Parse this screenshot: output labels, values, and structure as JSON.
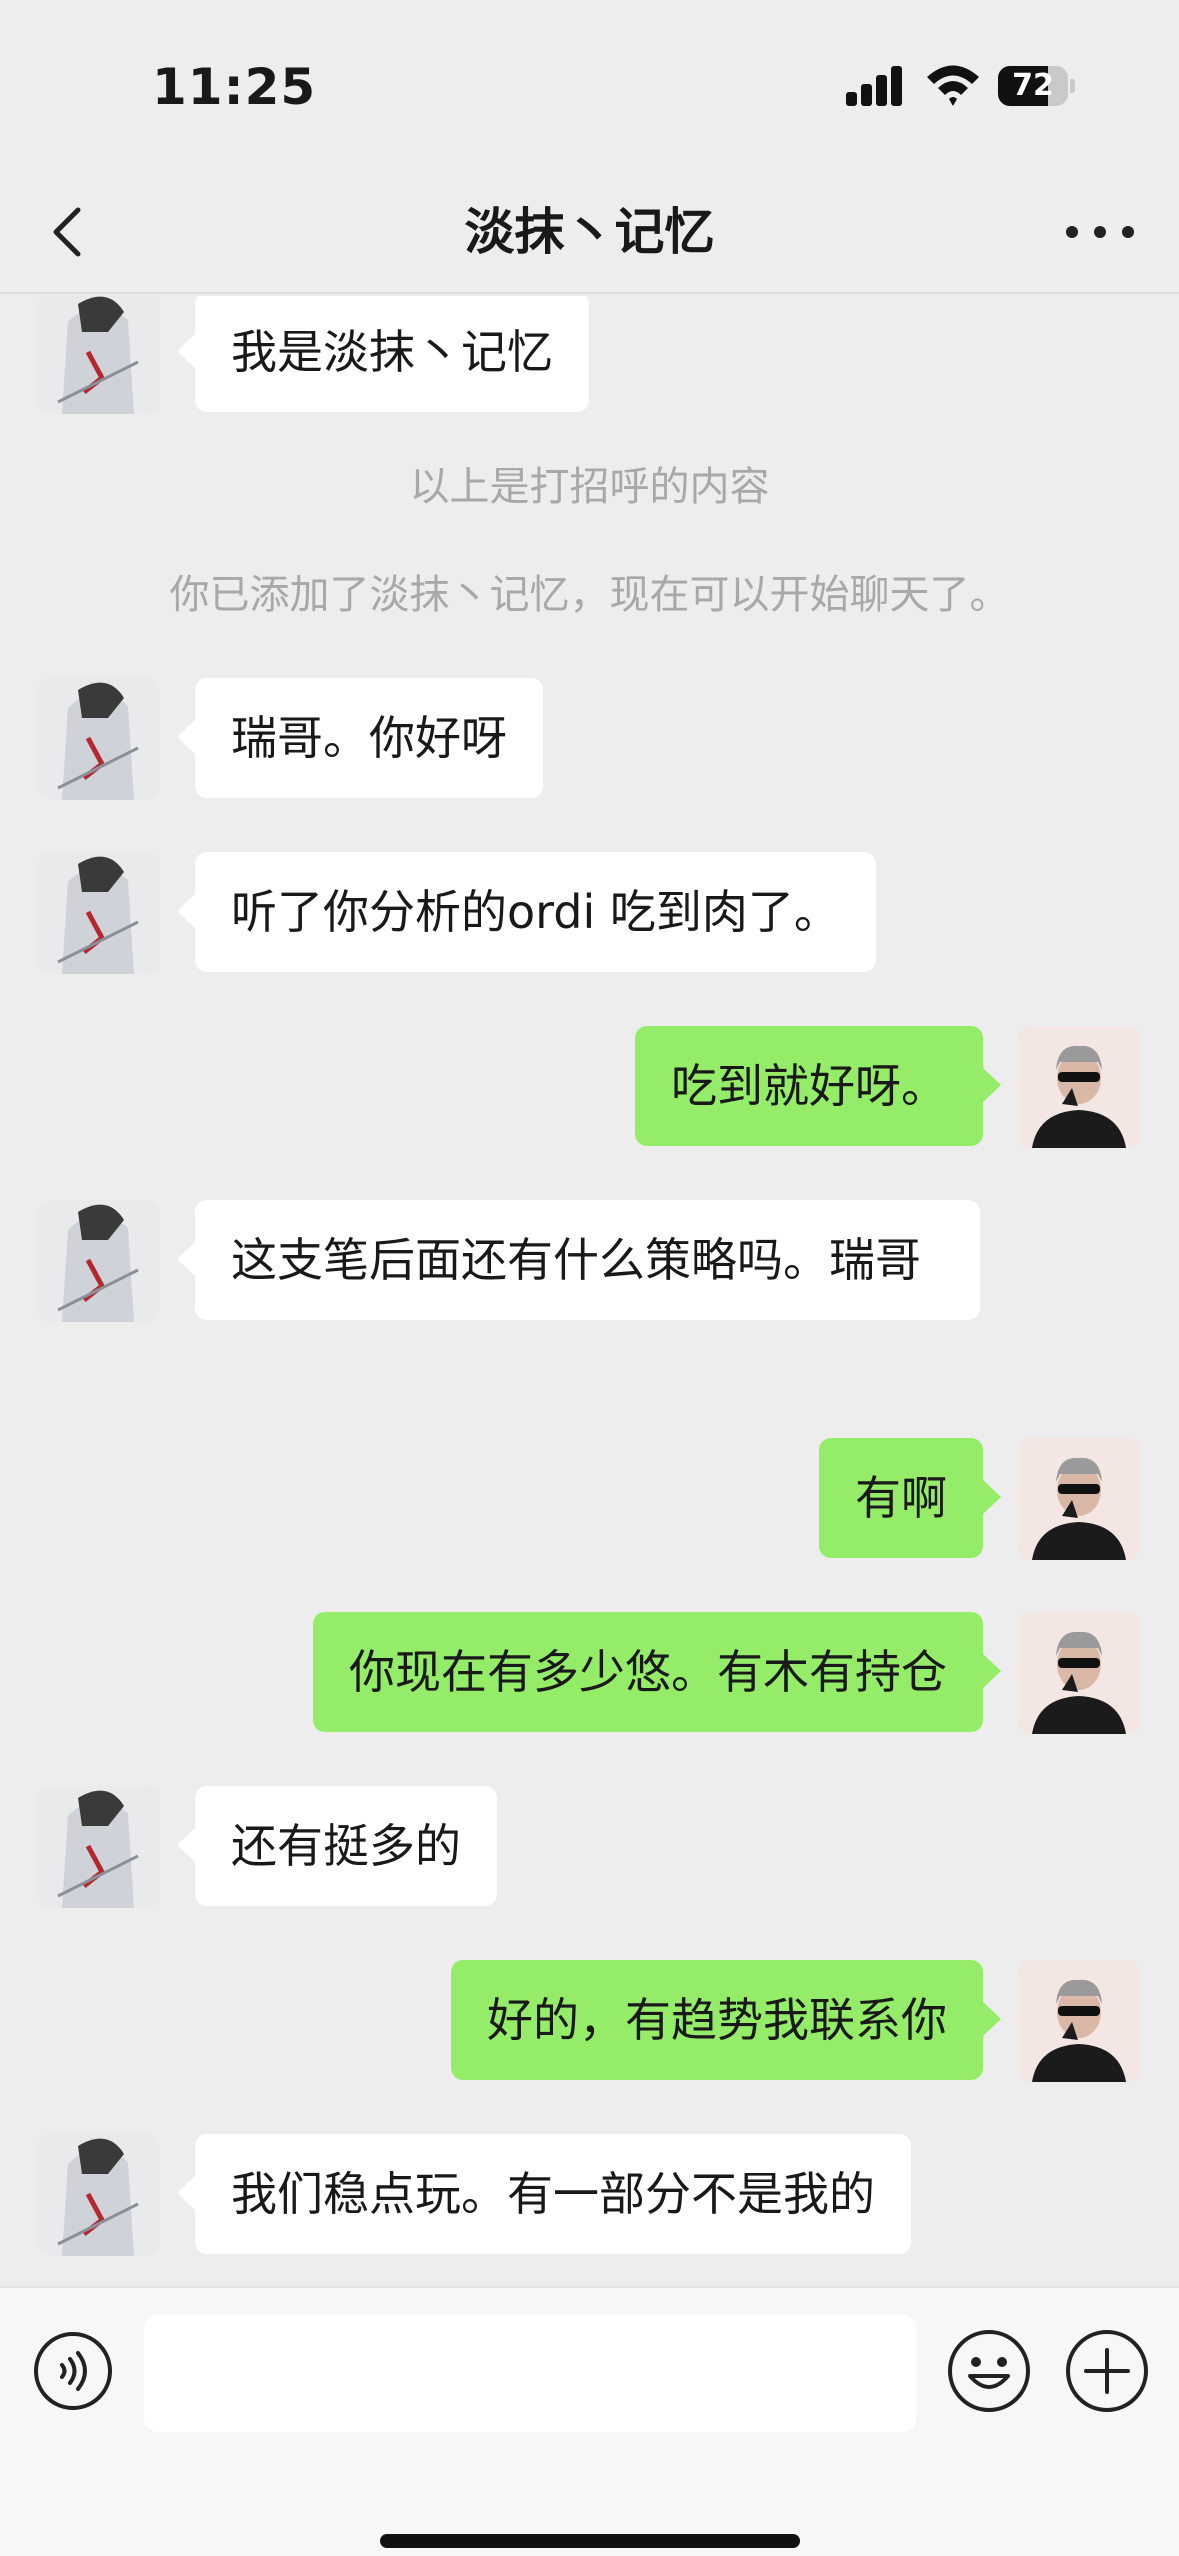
{
  "status_bar": {
    "time": "11:25",
    "battery": "72"
  },
  "nav": {
    "title": "淡抹丶记忆",
    "back_icon": "chevron-left-icon",
    "more_icon": "more-dots-icon"
  },
  "messages": [
    {
      "from": "them",
      "text": "我是淡抹丶记忆"
    },
    {
      "from": "system",
      "text": "以上是打招呼的内容"
    },
    {
      "from": "system",
      "text": "你已添加了淡抹丶记忆，现在可以开始聊天了。"
    },
    {
      "from": "them",
      "text": "瑞哥。你好呀"
    },
    {
      "from": "them",
      "text": "听了你分析的ordi 吃到肉了。"
    },
    {
      "from": "me",
      "text": "吃到就好呀。"
    },
    {
      "from": "them",
      "text": "这支笔后面还有什么策略吗。瑞哥"
    },
    {
      "from": "me",
      "text": "有啊"
    },
    {
      "from": "me",
      "text": "你现在有多少悠。有木有持仓"
    },
    {
      "from": "them",
      "text": "还有挺多的"
    },
    {
      "from": "me",
      "text": "好的，有趋势我联系你"
    },
    {
      "from": "them",
      "text": "我们稳点玩。有一部分不是我的"
    }
  ],
  "input_bar": {
    "voice_icon": "voice-icon",
    "emoji_icon": "emoji-icon",
    "plus_icon": "plus-icon",
    "placeholder": ""
  },
  "colors": {
    "background": "#ededed",
    "outgoing_bubble": "#95ec69",
    "incoming_bubble": "#ffffff",
    "system_text": "#a8a8a8"
  }
}
